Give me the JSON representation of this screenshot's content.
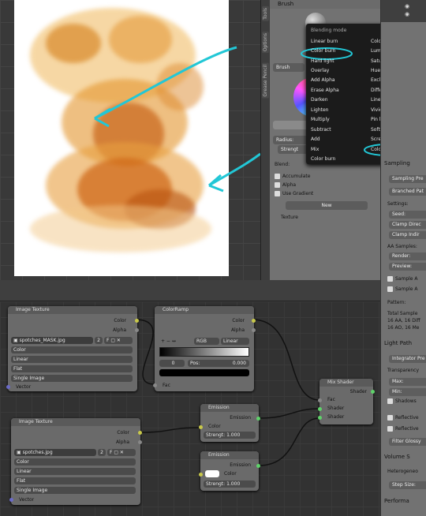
{
  "brush_panel": {
    "title": "Brush",
    "brush_field": "Brush",
    "radius_label": "Radius:",
    "strength_label": "Strengt",
    "blend_label": "Blend:",
    "accumulate": "Accumulate",
    "alpha": "Alpha",
    "use_gradient": "Use Gradient",
    "new_button": "New",
    "texture_label": "Texture"
  },
  "tool_tabs": [
    "Tools",
    "Options",
    "Grease Pencil"
  ],
  "blend_menu": {
    "header": "Blending mode",
    "left": [
      "Linear burn",
      "Color burn",
      "Hard light",
      "Overlay",
      "Add Alpha",
      "Erase Alpha",
      "Darken",
      "Lighten",
      "Multiply",
      "Subtract",
      "Add",
      "Mix",
      "Color burn"
    ],
    "right": [
      "Color",
      "Luminosity",
      "Saturation",
      "Hue",
      "Exclusion",
      "Difference",
      "Linear light",
      "Vivid light",
      "Pin light",
      "Soft light",
      "Screen",
      "Color dodge"
    ],
    "highlight_left": "Color burn",
    "highlight_right": "Color dodge"
  },
  "right_panel": {
    "sampling_head": "Sampling",
    "sampling_presets": "Sampling Pre",
    "branched": "Branched Pat",
    "settings": "Settings:",
    "seed": "Seed:",
    "clamp_direct": "Clamp Direc",
    "clamp_indirect": "Clamp Indir",
    "aa_samples": "AA Samples:",
    "render": "Render:",
    "preview": "Preview:",
    "sample_a1": "Sample A",
    "sample_a2": "Sample A",
    "pattern": "Pattern:",
    "total_samples": "Total Sample",
    "aa16_1": "16 AA, 16 Diff",
    "aa16_2": "16 AO, 16 Me",
    "light_paths": "Light Path",
    "integrator": "Integrator Pre",
    "transparency": "Transparency",
    "max": "Max:",
    "min": "Min:",
    "shadows": "Shadows",
    "reflective1": "Reflective",
    "reflective2": "Reflective",
    "filter_glossy": "Filter Glossy",
    "volume": "Volume S",
    "heterogeneous": "Heterogeneo",
    "step_size": "Step Size:",
    "performance": "Performa"
  },
  "nodes": {
    "image_texture_1": {
      "title": "Image Texture",
      "out_color": "Color",
      "out_alpha": "Alpha",
      "image": "spotches_MASK.jpg",
      "users": "2",
      "opts": [
        "Color",
        "Linear",
        "Flat",
        "Single Image"
      ],
      "in_vector": "Vector"
    },
    "color_ramp": {
      "title": "ColorRamp",
      "out_color": "Color",
      "out_alpha": "Alpha",
      "mode": "RGB",
      "interp": "Linear",
      "index": "0",
      "pos_label": "Pos:",
      "pos_value": "0.000",
      "in_fac": "Fac"
    },
    "image_texture_2": {
      "title": "Image Texture",
      "out_color": "Color",
      "out_alpha": "Alpha",
      "image": "spotches.jpg",
      "users": "2",
      "opts": [
        "Color",
        "Linear",
        "Flat",
        "Single Image"
      ],
      "in_vector": "Vector"
    },
    "emission_1": {
      "title": "Emission",
      "out": "Emission",
      "in_color": "Color",
      "strength": "Strengt: 1.000"
    },
    "emission_2": {
      "title": "Emission",
      "out": "Emission",
      "in_color": "Color",
      "strength": "Strengt: 1.000"
    },
    "mix_shader": {
      "title": "Mix Shader",
      "out": "Shader",
      "in_fac": "Fac",
      "in_shader1": "Shader",
      "in_shader2": "Shader"
    }
  },
  "colors": {
    "annotation": "#22c7d6",
    "stain_orange": "#e08a2a",
    "menu_bg": "#1b1b1b"
  }
}
